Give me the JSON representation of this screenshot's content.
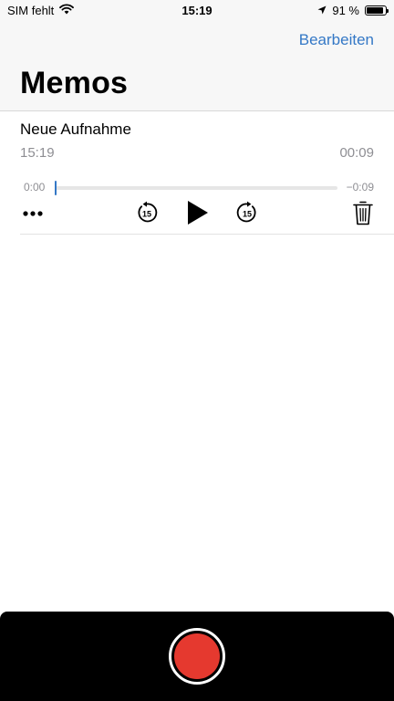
{
  "status_bar": {
    "carrier": "SIM fehlt",
    "time": "15:19",
    "battery": "91 %",
    "battery_level": 0.91
  },
  "nav": {
    "edit_label": "Bearbeiten",
    "title": "Memos"
  },
  "memos": [
    {
      "title": "Neue Aufnahme",
      "time": "15:19",
      "duration": "00:09",
      "elapsed": "0:00",
      "remaining": "−0:09",
      "progress": 0
    }
  ],
  "colors": {
    "accent": "#3478c6",
    "record": "#e5392f",
    "secondary_text": "#8e8e93"
  },
  "icons": {
    "wifi": "wifi-icon",
    "location": "location-arrow-icon",
    "battery": "battery-icon",
    "more": "more-dots-icon",
    "skip_back": "skip-back-15-icon",
    "play": "play-icon",
    "skip_forward": "skip-forward-15-icon",
    "trash": "trash-icon",
    "record": "record-icon"
  },
  "skip_seconds": "15"
}
